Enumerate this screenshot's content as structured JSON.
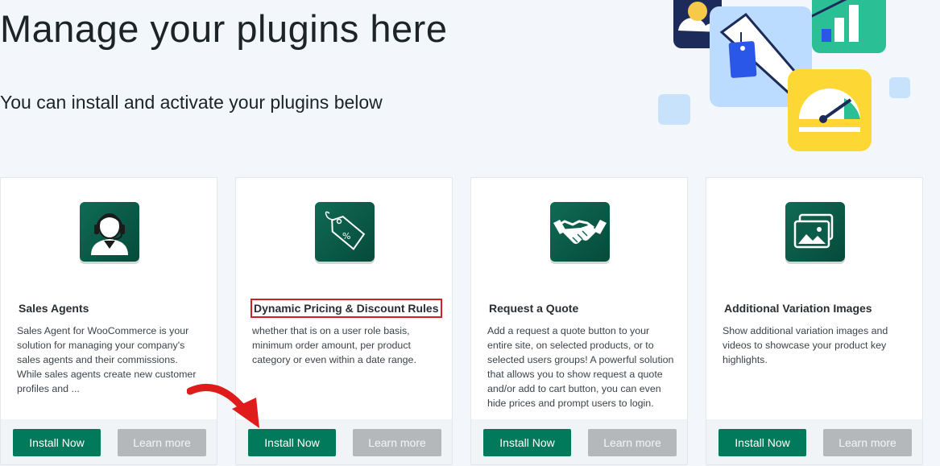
{
  "header": {
    "title": "Manage your plugins here",
    "subtitle": "You can install and activate your plugins below"
  },
  "cards": [
    {
      "title": "Sales Agents",
      "description": "Sales Agent for WooCommerce is your solution for managing your company's sales agents and their commissions. While sales agents create new customer profiles and ...",
      "icon": "support-agent-icon",
      "install_label": "Install Now",
      "learn_label": "Learn more"
    },
    {
      "title": "Dynamic Pricing & Discount Rules",
      "description": "whether that is on a user role basis, minimum order amount, per product category or even within a date range.",
      "icon": "price-tag-percent-icon",
      "install_label": "Install Now",
      "learn_label": "Learn more"
    },
    {
      "title": "Request a Quote",
      "description": "Add a request a quote button to your entire site, on selected products, or to selected users groups! A powerful solution that allows you to show request a quote and/or add to cart button, you can even hide prices and prompt users to login.",
      "icon": "handshake-icon",
      "install_label": "Install Now",
      "learn_label": "Learn more"
    },
    {
      "title": "Additional Variation Images",
      "description": "Show additional variation images and videos to showcase your product key highlights.",
      "icon": "image-gallery-icon",
      "install_label": "Install Now",
      "learn_label": "Learn more"
    }
  ],
  "colors": {
    "install_button": "#007a5a",
    "learn_button": "#b5b8bb",
    "highlight_box": "#d11f26",
    "icon_bg": "#0f6b55"
  }
}
